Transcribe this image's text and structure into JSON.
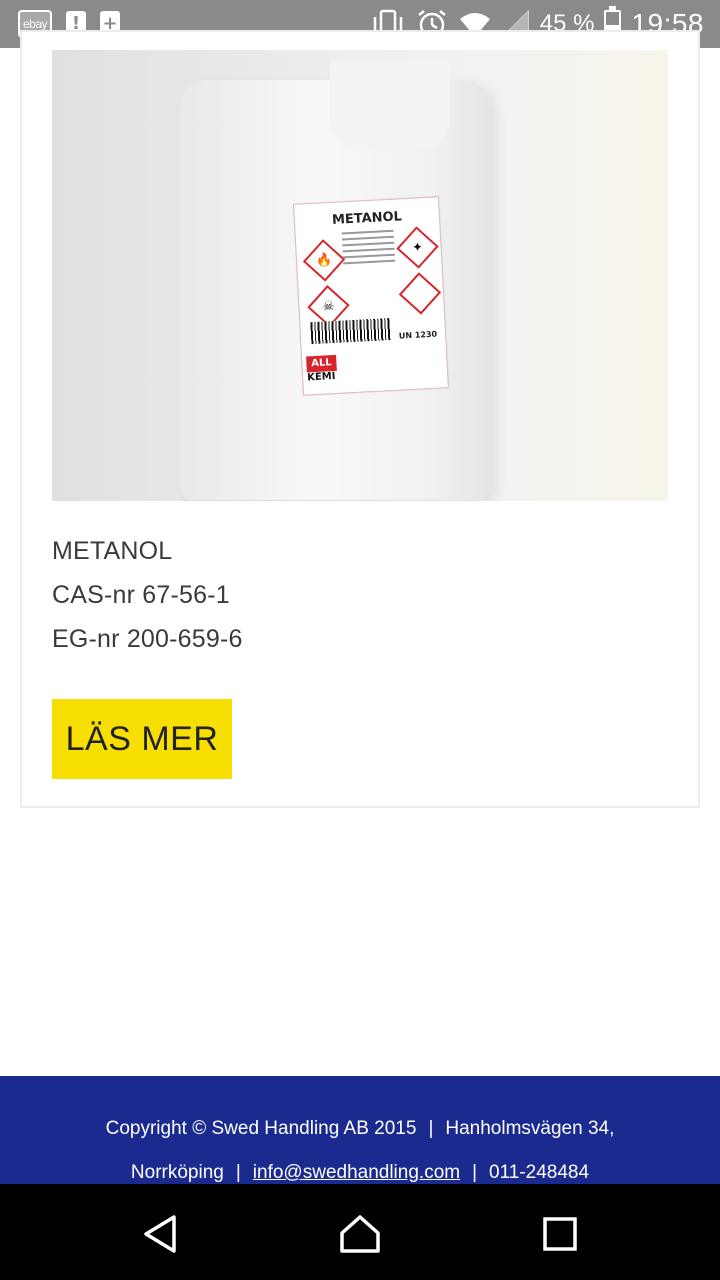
{
  "status_bar": {
    "ebay_label": "ebay",
    "notif1": "!",
    "notif2": "+",
    "battery_percent": "45 %",
    "battery_level": 0.45,
    "time": "19:58"
  },
  "product": {
    "image_label_title": "METANOL",
    "image_label_brand": "KEMI",
    "image_label_un": "UN 1230",
    "name": "METANOL",
    "cas": "CAS-nr 67-56-1",
    "eg": "EG-nr 200-659-6",
    "read_more_label": "LÄS MER"
  },
  "footer": {
    "copyright": "Copyright © Swed Handling AB 2015",
    "separator": "|",
    "address_part1": "Hanholmsvägen 34,",
    "address_part2": "Norrköping",
    "email": "info@swedhandling.com",
    "phone": "011-248484"
  },
  "colors": {
    "button_yellow": "#f7df04",
    "footer_blue": "#1b2a8f",
    "status_gray": "#8a8a8a"
  }
}
